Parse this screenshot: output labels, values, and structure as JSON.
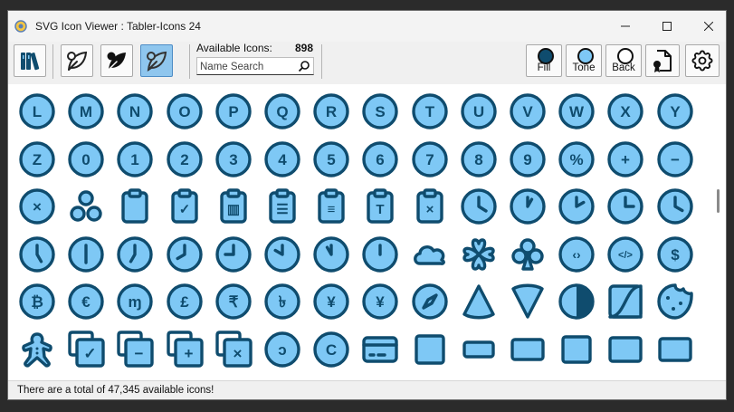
{
  "window": {
    "title": "SVG Icon Viewer : Tabler-Icons 24",
    "controls": [
      "minimize-icon",
      "maximize-icon",
      "close-icon"
    ]
  },
  "toolbar": {
    "buttons": [
      {
        "name": "library-button",
        "icon": "books-icon"
      },
      {
        "name": "outline-style-button",
        "icon": "leaf-outline-icon"
      },
      {
        "name": "filled-style-button",
        "icon": "leaf-filled-icon"
      },
      {
        "name": "duotone-style-button",
        "icon": "leaf-duotone-icon",
        "active": true
      }
    ],
    "available_label": "Available Icons:",
    "available_count": "898",
    "search_placeholder": "Name Search",
    "color_buttons": [
      {
        "name": "fill-color-button",
        "label": "Fill",
        "color": "#0f4c6e"
      },
      {
        "name": "tone-color-button",
        "label": "Tone",
        "color": "#7ec8f5"
      },
      {
        "name": "back-color-button",
        "label": "Back",
        "color": "#ffffff"
      }
    ],
    "export_icon": "file-certificate-icon",
    "settings_icon": "gear-icon"
  },
  "colors": {
    "fill": "#0f4c6e",
    "tone": "#7ec8f5",
    "back": "#ffffff",
    "accent": "#8fc6ee"
  },
  "icons": {
    "rows": [
      [
        {
          "icon": "circle-letter-l-icon",
          "glyph": "L"
        },
        {
          "icon": "circle-letter-m-icon",
          "glyph": "M"
        },
        {
          "icon": "circle-letter-n-icon",
          "glyph": "N"
        },
        {
          "icon": "circle-letter-o-icon",
          "glyph": "O"
        },
        {
          "icon": "circle-letter-p-icon",
          "glyph": "P"
        },
        {
          "icon": "circle-letter-q-icon",
          "glyph": "Q"
        },
        {
          "icon": "circle-letter-r-icon",
          "glyph": "R"
        },
        {
          "icon": "circle-letter-s-icon",
          "glyph": "S"
        },
        {
          "icon": "circle-letter-t-icon",
          "glyph": "T"
        },
        {
          "icon": "circle-letter-u-icon",
          "glyph": "U"
        },
        {
          "icon": "circle-letter-v-icon",
          "glyph": "V"
        },
        {
          "icon": "circle-letter-w-icon",
          "glyph": "W"
        },
        {
          "icon": "circle-letter-x-icon",
          "glyph": "X"
        },
        {
          "icon": "circle-letter-y-icon",
          "glyph": "Y"
        }
      ],
      [
        {
          "icon": "circle-letter-z-icon",
          "glyph": "Z"
        },
        {
          "icon": "circle-number-0-icon",
          "glyph": "0"
        },
        {
          "icon": "circle-number-1-icon",
          "glyph": "1"
        },
        {
          "icon": "circle-number-2-icon",
          "glyph": "2"
        },
        {
          "icon": "circle-number-3-icon",
          "glyph": "3"
        },
        {
          "icon": "circle-number-4-icon",
          "glyph": "4"
        },
        {
          "icon": "circle-number-5-icon",
          "glyph": "5"
        },
        {
          "icon": "circle-number-6-icon",
          "glyph": "6"
        },
        {
          "icon": "circle-number-7-icon",
          "glyph": "7"
        },
        {
          "icon": "circle-number-8-icon",
          "glyph": "8"
        },
        {
          "icon": "circle-number-9-icon",
          "glyph": "9"
        },
        {
          "icon": "circle-percentage-icon",
          "glyph": "%"
        },
        {
          "icon": "circle-plus-icon",
          "glyph": "+"
        },
        {
          "icon": "circle-minus-icon",
          "glyph": "−"
        }
      ],
      [
        {
          "icon": "circle-x-icon",
          "glyph": "×"
        },
        {
          "icon": "circles-icon",
          "glyph": ""
        },
        {
          "icon": "clipboard-icon",
          "glyph": ""
        },
        {
          "icon": "clipboard-check-icon",
          "glyph": "✓"
        },
        {
          "icon": "clipboard-data-icon",
          "glyph": "▥"
        },
        {
          "icon": "clipboard-list-icon",
          "glyph": "☰"
        },
        {
          "icon": "clipboard-text-icon",
          "glyph": "≡"
        },
        {
          "icon": "clipboard-typography-icon",
          "glyph": "T"
        },
        {
          "icon": "clipboard-x-icon",
          "glyph": "×"
        },
        {
          "icon": "clock-icon",
          "glyph": ""
        },
        {
          "icon": "clock-1-icon",
          "glyph": ""
        },
        {
          "icon": "clock-2-icon",
          "glyph": ""
        },
        {
          "icon": "clock-3-icon",
          "glyph": ""
        },
        {
          "icon": "clock-4-icon",
          "glyph": ""
        }
      ],
      [
        {
          "icon": "clock-5-icon",
          "glyph": ""
        },
        {
          "icon": "clock-6-icon",
          "glyph": ""
        },
        {
          "icon": "clock-7-icon",
          "glyph": ""
        },
        {
          "icon": "clock-8-icon",
          "glyph": ""
        },
        {
          "icon": "clock-9-icon",
          "glyph": ""
        },
        {
          "icon": "clock-10-icon",
          "glyph": ""
        },
        {
          "icon": "clock-11-icon",
          "glyph": ""
        },
        {
          "icon": "clock-12-icon",
          "glyph": ""
        },
        {
          "icon": "cloud-icon",
          "glyph": ""
        },
        {
          "icon": "clover-icon",
          "glyph": ""
        },
        {
          "icon": "clubs-icon",
          "glyph": "♣"
        },
        {
          "icon": "code-circle-icon",
          "glyph": "‹›"
        },
        {
          "icon": "code-circle-2-icon",
          "glyph": "</>"
        },
        {
          "icon": "coin-icon",
          "glyph": "$"
        }
      ],
      [
        {
          "icon": "coin-bitcoin-icon",
          "glyph": "₿"
        },
        {
          "icon": "coin-euro-icon",
          "glyph": "€"
        },
        {
          "icon": "coin-monero-icon",
          "glyph": "ɱ"
        },
        {
          "icon": "coin-pound-icon",
          "glyph": "£"
        },
        {
          "icon": "coin-rupee-icon",
          "glyph": "₹"
        },
        {
          "icon": "coin-taka-icon",
          "glyph": "৳"
        },
        {
          "icon": "coin-yen-icon",
          "glyph": "¥"
        },
        {
          "icon": "coin-yuan-icon",
          "glyph": "¥"
        },
        {
          "icon": "compass-icon",
          "glyph": ""
        },
        {
          "icon": "cone-icon",
          "glyph": ""
        },
        {
          "icon": "cone-2-icon",
          "glyph": ""
        },
        {
          "icon": "contrast-icon",
          "glyph": ""
        },
        {
          "icon": "contrast-2-icon",
          "glyph": ""
        },
        {
          "icon": "cookie-icon",
          "glyph": ""
        }
      ],
      [
        {
          "icon": "cookie-man-icon",
          "glyph": ""
        },
        {
          "icon": "copy-check-icon",
          "glyph": "✓"
        },
        {
          "icon": "copy-minus-icon",
          "glyph": "−"
        },
        {
          "icon": "copy-plus-icon",
          "glyph": "+"
        },
        {
          "icon": "copy-x-icon",
          "glyph": "×"
        },
        {
          "icon": "copyleft-icon",
          "glyph": "ↄ"
        },
        {
          "icon": "copyright-icon",
          "glyph": "C"
        },
        {
          "icon": "credit-card-icon",
          "glyph": ""
        },
        {
          "icon": "crop-1-1-icon",
          "glyph": ""
        },
        {
          "icon": "crop-16-9-icon",
          "glyph": ""
        },
        {
          "icon": "crop-3-2-icon",
          "glyph": ""
        },
        {
          "icon": "crop-5-4-icon",
          "glyph": ""
        },
        {
          "icon": "crop-7-5-icon",
          "glyph": ""
        },
        {
          "icon": "crop-landscape-icon",
          "glyph": ""
        }
      ]
    ]
  },
  "status": {
    "text": "There are a total of 47,345 available icons!"
  }
}
